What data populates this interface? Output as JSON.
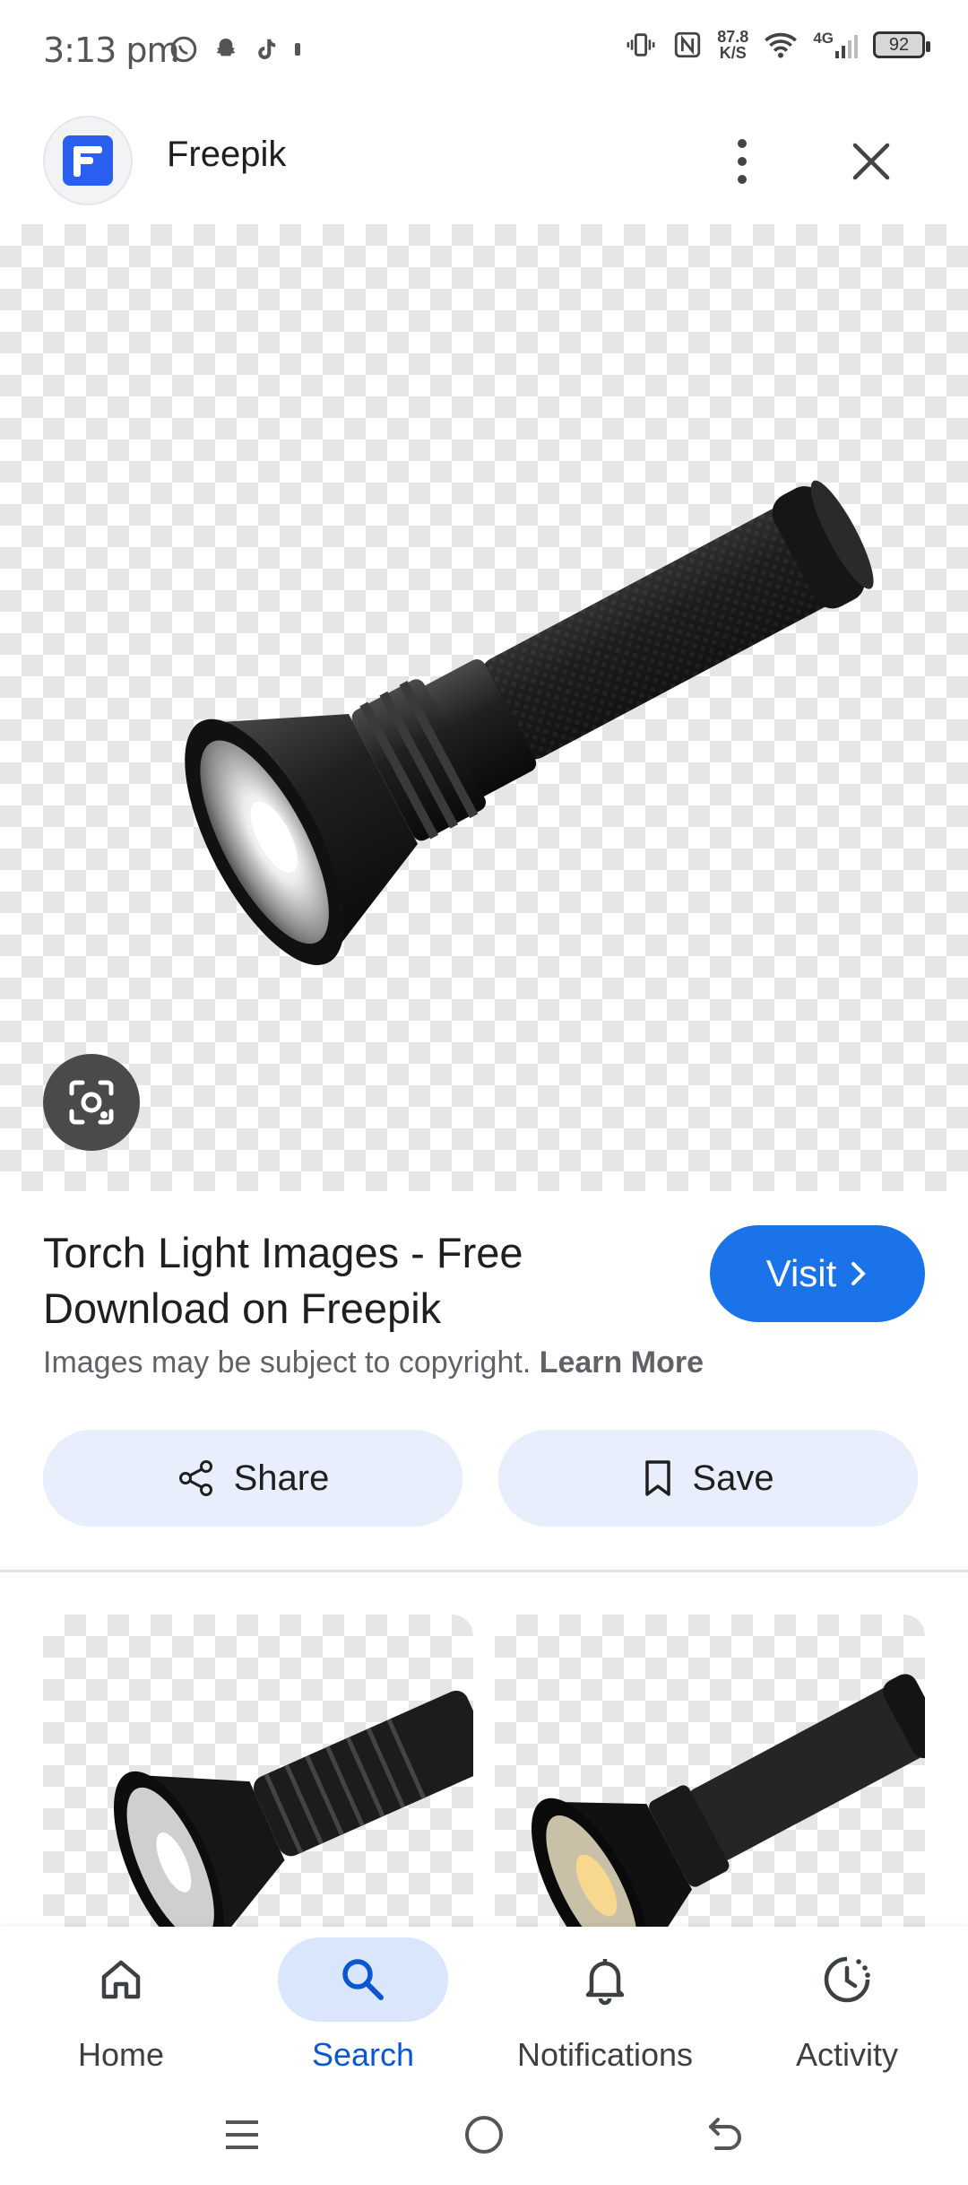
{
  "status_bar": {
    "time": "3:13 pm",
    "net_speed_value": "87.8",
    "net_speed_unit": "K/S",
    "network_type": "4G",
    "battery": "92"
  },
  "header": {
    "site_name": "Freepik"
  },
  "result": {
    "title": "Torch Light Images - Free Download on Freepik",
    "visit_label": "Visit",
    "copyright_text": "Images may be subject to copyright.",
    "learn_more": "Learn More",
    "share_label": "Share",
    "save_label": "Save"
  },
  "bottom_nav": {
    "items": [
      {
        "label": "Home",
        "icon": "home-icon"
      },
      {
        "label": "Search",
        "icon": "search-icon",
        "active": true
      },
      {
        "label": "Notifications",
        "icon": "bell-icon"
      },
      {
        "label": "Activity",
        "icon": "activity-icon"
      }
    ]
  },
  "colors": {
    "accent": "#1a73e8",
    "active_nav": "#0b57d0",
    "chip_bg": "#e8eefc"
  }
}
